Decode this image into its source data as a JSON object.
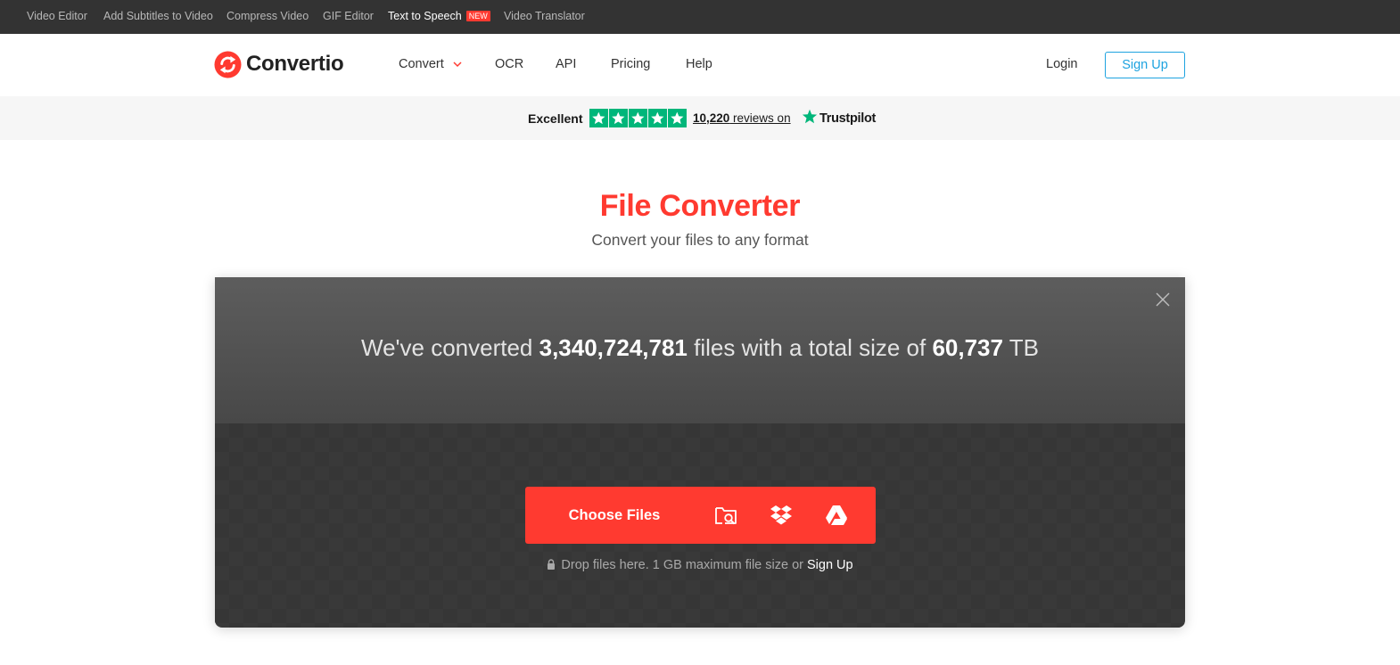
{
  "topbar": {
    "links": [
      {
        "label": "Video Editor"
      },
      {
        "label": "Add Subtitles to Video"
      },
      {
        "label": "Compress Video"
      },
      {
        "label": "GIF Editor"
      },
      {
        "label": "Text to Speech",
        "badge": "NEW"
      },
      {
        "label": "Video Translator"
      }
    ]
  },
  "header": {
    "brand": "Convertio",
    "nav": [
      {
        "label": "Convert"
      },
      {
        "label": "OCR"
      },
      {
        "label": "API"
      },
      {
        "label": "Pricing"
      },
      {
        "label": "Help"
      }
    ],
    "login_label": "Login",
    "signup_label": "Sign Up"
  },
  "trustpilot": {
    "rating_text": "Excellent",
    "stars": 5,
    "review_count": "10,220",
    "reviews_suffix": " reviews on",
    "brand": "Trustpilot"
  },
  "hero": {
    "title": "File Converter",
    "subtitle": "Convert your files to any format"
  },
  "stats": {
    "prefix": "We've converted ",
    "files_count": "3,340,724,781",
    "middle": " files with a total size of ",
    "total_size": "60,737",
    "unit": " TB"
  },
  "upload": {
    "choose_label": "Choose Files",
    "sources": [
      "folder-search-icon",
      "dropbox-icon",
      "google-drive-icon"
    ],
    "hint": "Drop files here. 1 GB maximum file size or ",
    "hint_link": "Sign Up"
  },
  "colors": {
    "accent": "#ff3a30",
    "link_blue": "#1ea3e0",
    "trustpilot_green": "#00b67a",
    "topbar_bg": "#333333"
  }
}
